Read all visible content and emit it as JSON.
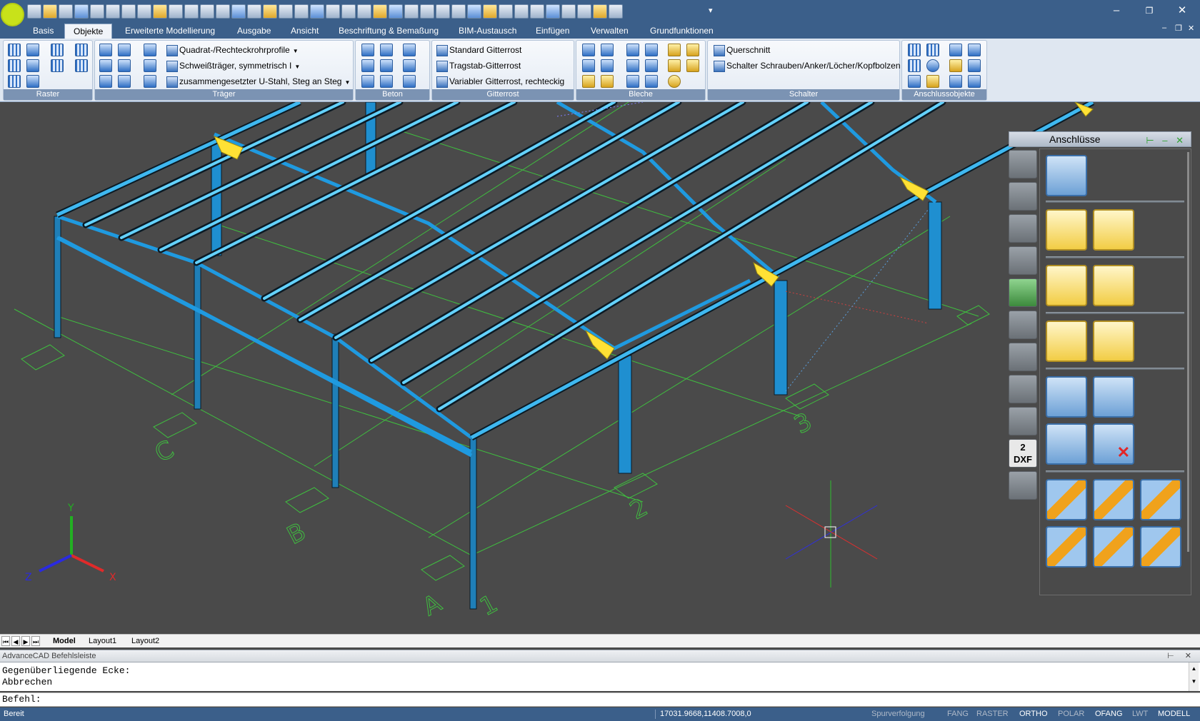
{
  "quick_access": {
    "icons": [
      "new-icon",
      "open-icon",
      "save-icon",
      "saveas-icon",
      "undo-icon",
      "redo-icon",
      "print-icon",
      "preview-icon",
      "properties-icon",
      "layer-icon",
      "table-icon",
      "hatch-icon",
      "draw-icon",
      "polyline-icon",
      "view-1-icon",
      "view-2-icon",
      "view-3-icon",
      "view-4-icon",
      "view-5-icon",
      "view-6-icon",
      "view-7-icon",
      "view-8-icon",
      "view-9-icon",
      "snap-icon",
      "zoom-1-icon",
      "zoom-2-icon",
      "zoom-3-icon",
      "zoom-4-icon",
      "zoom-5-icon",
      "measure-icon",
      "dimension-icon",
      "section-icon",
      "render-icon",
      "info-icon",
      "tool-1-icon",
      "tool-2-icon",
      "tool-3-icon",
      "tool-4-icon"
    ]
  },
  "window": {
    "minimize": "–",
    "restore": "❐",
    "close": "✕"
  },
  "tabs": [
    {
      "label": "Basis",
      "active": false
    },
    {
      "label": "Objekte",
      "active": true
    },
    {
      "label": "Erweiterte Modellierung",
      "active": false
    },
    {
      "label": "Ausgabe",
      "active": false
    },
    {
      "label": "Ansicht",
      "active": false
    },
    {
      "label": "Beschriftung & Bemaßung",
      "active": false
    },
    {
      "label": "BIM-Austausch",
      "active": false
    },
    {
      "label": "Einfügen",
      "active": false
    },
    {
      "label": "Verwalten",
      "active": false
    },
    {
      "label": "Grundfunktionen",
      "active": false
    }
  ],
  "mdi_controls": {
    "minimize": "–",
    "restore": "❐",
    "close": "✕"
  },
  "ribbon": {
    "groups": {
      "raster": "Raster",
      "traeger": "Träger",
      "beton": "Beton",
      "gitterrost": "Gitterrost",
      "bleche": "Bleche",
      "schalter": "Schalter",
      "anschlussobjekte": "Anschlussobjekte"
    },
    "traeger_items": [
      "Quadrat-/Rechteckrohrprofile",
      "Schweißträger, symmetrisch I",
      "zusammengesetzter U-Stahl, Steg an Steg"
    ],
    "gitterrost_items": [
      "Standard Gitterrost",
      "Tragstab-Gitterrost",
      "Variabler Gitterrost, rechteckig"
    ],
    "schalter_items": [
      "Querschnitt",
      "Schalter Schrauben/Anker/Löcher/Kopfbolzen"
    ]
  },
  "palette": {
    "title": "Anschlüsse",
    "controls": "⊢ – ✕",
    "side_dxf_label": "2\nDXF"
  },
  "drawing": {
    "axis_labels": {
      "x": "X",
      "y": "Y",
      "z": "Z"
    },
    "grid_labels": [
      "A",
      "B",
      "C",
      "1",
      "2",
      "3"
    ]
  },
  "layout_tabs": [
    {
      "label": "Model",
      "active": true
    },
    {
      "label": "Layout1",
      "active": false
    },
    {
      "label": "Layout2",
      "active": false
    }
  ],
  "command": {
    "title": "AdvanceCAD Befehlsleiste",
    "controls": "⊢ ✕",
    "history": [
      "Gegenüberliegende Ecke:",
      "Abbrechen"
    ],
    "prompt": "Befehl:"
  },
  "status": {
    "ready": "Bereit",
    "coordinates": "17031.9668,11408.7008,0",
    "toggles": [
      {
        "label": "Spurverfolgung",
        "on": false
      },
      {
        "label": "FANG",
        "on": false
      },
      {
        "label": "RASTER",
        "on": false
      },
      {
        "label": "ORTHO",
        "on": true
      },
      {
        "label": "POLAR",
        "on": false
      },
      {
        "label": "OFANG",
        "on": true
      },
      {
        "label": "LWT",
        "on": false
      },
      {
        "label": "MODELL",
        "on": true
      }
    ]
  },
  "colors": {
    "titlebar": "#3b5f8a",
    "canvas": "#4a4a4a",
    "beam": "#1f8fd0",
    "beam_highlight": "#8fe0ff",
    "grid": "#3fbf3f",
    "connection": "#ffe135"
  }
}
